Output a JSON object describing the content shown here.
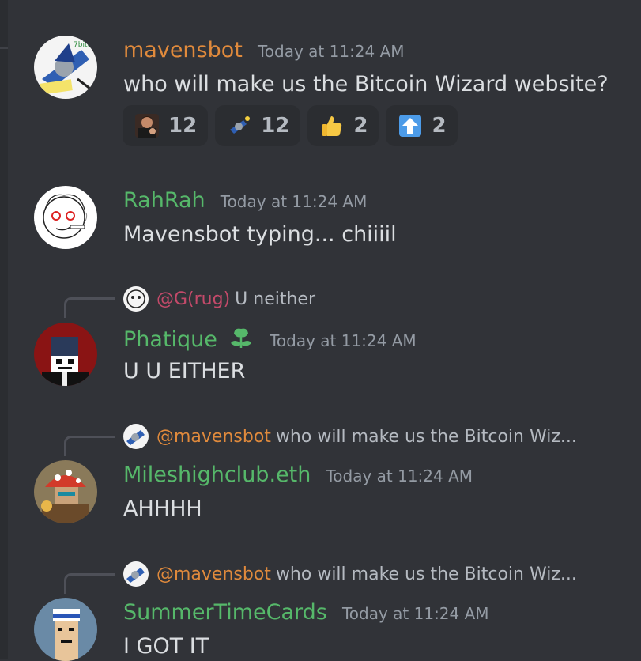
{
  "messages": [
    {
      "author": "mavensbot",
      "author_color": "#e08a3c",
      "time": "Today at 11:24 AM",
      "text": "who will make us the Bitcoin Wizard website?",
      "reactions": [
        {
          "emoji": "man-pointing-emoji",
          "count": "12"
        },
        {
          "emoji": "wizard-emoji",
          "count": "12"
        },
        {
          "emoji": "thumbs-up-emoji",
          "count": "2"
        },
        {
          "emoji": "up-arrow-emoji",
          "count": "2"
        }
      ]
    },
    {
      "author": "RahRah",
      "author_color": "#56b86a",
      "time": "Today at 11:24 AM",
      "text": "Mavensbot typing... chiiiil"
    },
    {
      "reply_to": {
        "mention": "@G(rug)",
        "text": "U neither"
      },
      "author": "Phatique",
      "author_color": "#56b86a",
      "badge": "leaf-badge-icon",
      "time": "Today at 11:24 AM",
      "text": "U U EITHER"
    },
    {
      "reply_to": {
        "mention": "@mavensbot",
        "text": "who will make us the Bitcoin Wiz..."
      },
      "author": "Mileshighclub.eth",
      "author_color": "#56b86a",
      "time": "Today at 11:24 AM",
      "text": "AHHHH"
    },
    {
      "reply_to": {
        "mention": "@mavensbot",
        "text": "who will make us the Bitcoin Wiz..."
      },
      "author": "SummerTimeCards",
      "author_color": "#56b86a",
      "time": "Today at 11:24 AM",
      "text": "I GOT IT"
    }
  ]
}
